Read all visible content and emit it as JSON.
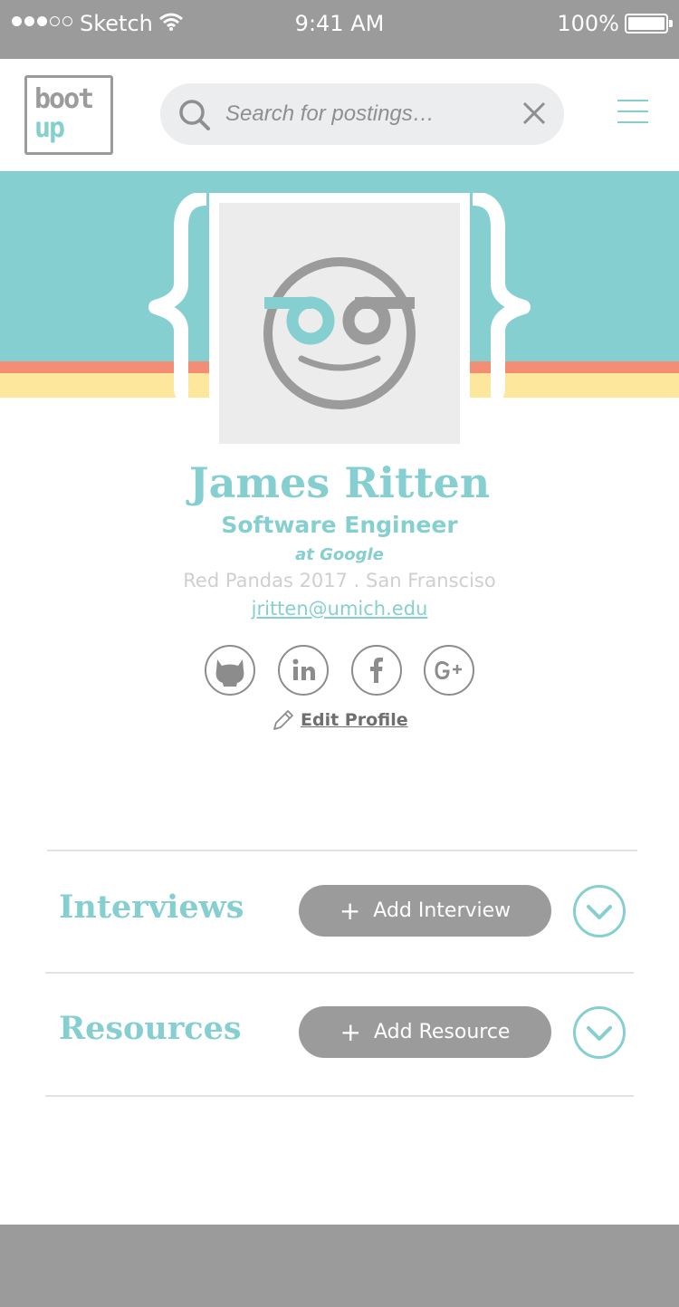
{
  "status_bar": {
    "carrier": "Sketch",
    "time": "9:41 AM",
    "battery": "100%"
  },
  "nav": {
    "logo_line1": "boot",
    "logo_line2": "up",
    "search_placeholder": "Search for postings…"
  },
  "profile": {
    "name": "James Ritten",
    "title": "Software Engineer",
    "company": "at Google",
    "meta": "Red Pandas 2017 . San Fransciso",
    "email": "jritten@umich.edu",
    "social": [
      "github-icon",
      "linkedin-icon",
      "facebook-icon",
      "google-plus-icon"
    ],
    "edit_label": "Edit Profile"
  },
  "sections": {
    "interviews": {
      "title": "Interviews",
      "button": "Add Interview"
    },
    "resources": {
      "title": "Resources",
      "button": "Add Resource"
    }
  },
  "colors": {
    "accent": "#86cfd1",
    "gray": "#9b9b9b",
    "coral": "#f38d73",
    "yellow": "#fde79c"
  }
}
